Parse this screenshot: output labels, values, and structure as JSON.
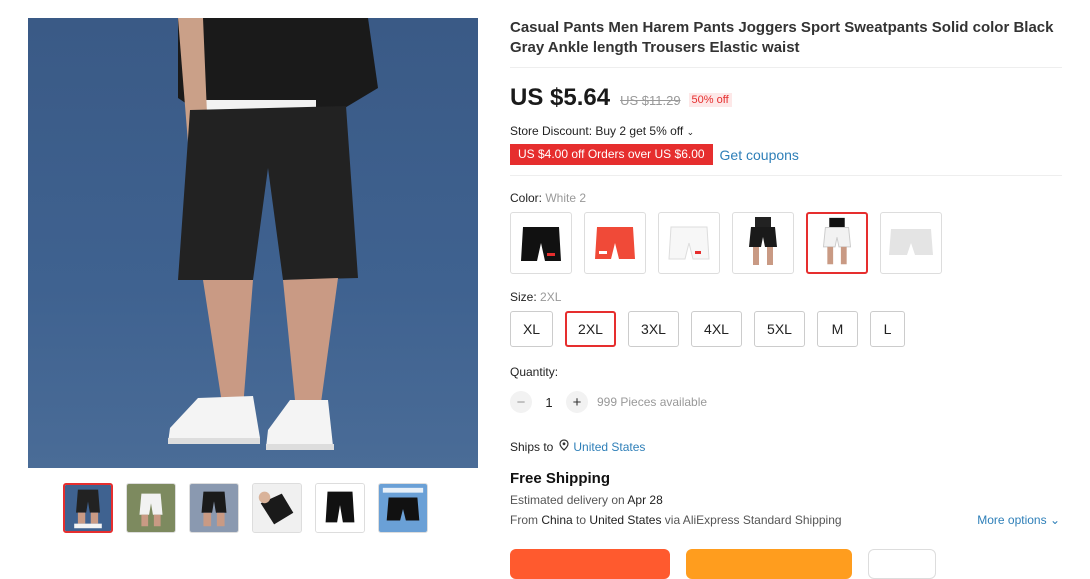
{
  "product": {
    "title": "Casual Pants Men Harem Pants Joggers Sport Sweatpants Solid color Black Gray Ankle length Trousers Elastic waist",
    "price": "US $5.64",
    "original_price": "US $11.29",
    "discount": "50% off",
    "store_discount": "Store Discount: Buy 2 get 5% off",
    "coupon_text": "US $4.00 off Orders over US $6.00",
    "get_coupons": "Get coupons"
  },
  "color": {
    "label": "Color: ",
    "selected": "White 2",
    "options": [
      "black-shorts",
      "red-shorts",
      "white-shorts",
      "model-black",
      "model-white",
      "gray-shorts"
    ],
    "active_index": 4
  },
  "size": {
    "label": "Size: ",
    "selected": "2XL",
    "options": [
      "XL",
      "2XL",
      "3XL",
      "4XL",
      "5XL",
      "M",
      "L"
    ]
  },
  "quantity": {
    "label": "Quantity:",
    "minus": "−",
    "plus": "+",
    "value": "1",
    "available": "999 Pieces available"
  },
  "shipping": {
    "ships_to_label": "Ships to",
    "ships_to": "United States",
    "free": "Free Shipping",
    "est_label": "Estimated delivery on",
    "est_date": "Apr 28",
    "from_label": "From",
    "from": "China",
    "to_label": "to",
    "to": "United States",
    "via": "via AliExpress Standard Shipping",
    "more": "More options"
  },
  "colors": {
    "accent": "#e62e2e",
    "link": "#2e7fb8",
    "buy": "#ff5a2e",
    "cart": "#ff9d1e"
  }
}
